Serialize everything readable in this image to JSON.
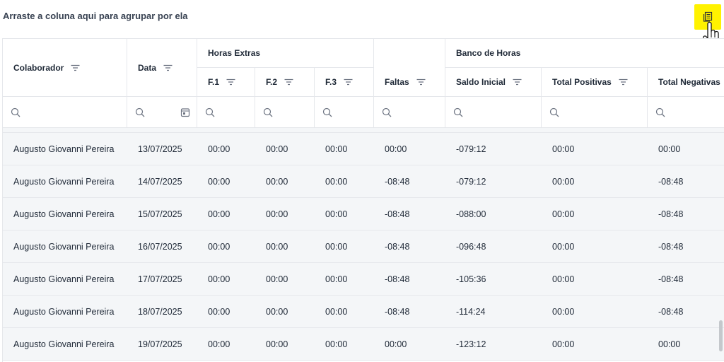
{
  "group_panel": {
    "hint": "Arraste a coluna aqui para agrupar por ela"
  },
  "columns": [
    {
      "id": "colaborador",
      "label": "Colaborador"
    },
    {
      "id": "data",
      "label": "Data"
    },
    {
      "id": "f1",
      "label": "F.1"
    },
    {
      "id": "f2",
      "label": "F.2"
    },
    {
      "id": "f3",
      "label": "F.3"
    },
    {
      "id": "faltas",
      "label": "Faltas"
    },
    {
      "id": "saldo_inicial",
      "label": "Saldo Inicial"
    },
    {
      "id": "total_positivas",
      "label": "Total Positivas"
    },
    {
      "id": "total_negativas",
      "label": "Total Negativas"
    }
  ],
  "column_groups": {
    "horas_extras": "Horas Extras",
    "banco_de_horas": "Banco de Horas"
  },
  "rows": [
    [
      "Augusto Giovanni Pereira",
      "13/07/2025",
      "00:00",
      "00:00",
      "00:00",
      "00:00",
      "-079:12",
      "00:00",
      "00:00"
    ],
    [
      "Augusto Giovanni Pereira",
      "14/07/2025",
      "00:00",
      "00:00",
      "00:00",
      "-08:48",
      "-079:12",
      "00:00",
      "-08:48"
    ],
    [
      "Augusto Giovanni Pereira",
      "15/07/2025",
      "00:00",
      "00:00",
      "00:00",
      "-08:48",
      "-088:00",
      "00:00",
      "-08:48"
    ],
    [
      "Augusto Giovanni Pereira",
      "16/07/2025",
      "00:00",
      "00:00",
      "00:00",
      "-08:48",
      "-096:48",
      "00:00",
      "-08:48"
    ],
    [
      "Augusto Giovanni Pereira",
      "17/07/2025",
      "00:00",
      "00:00",
      "00:00",
      "-08:48",
      "-105:36",
      "00:00",
      "-08:48"
    ],
    [
      "Augusto Giovanni Pereira",
      "18/07/2025",
      "00:00",
      "00:00",
      "00:00",
      "-08:48",
      "-114:24",
      "00:00",
      "-08:48"
    ],
    [
      "Augusto Giovanni Pereira",
      "19/07/2025",
      "00:00",
      "00:00",
      "00:00",
      "00:00",
      "-123:12",
      "00:00",
      "00:00"
    ]
  ],
  "icons": {
    "column_chooser": "column-chooser-icon",
    "cursor": "hand-pointer-icon",
    "header_menu": "filter-lines-icon",
    "filter_search": "search-icon",
    "date_picker": "calendar-icon"
  },
  "colors": {
    "chooser_highlight": "#fff200",
    "row_background": "#f4f6f8",
    "border": "#e5e7eb"
  }
}
